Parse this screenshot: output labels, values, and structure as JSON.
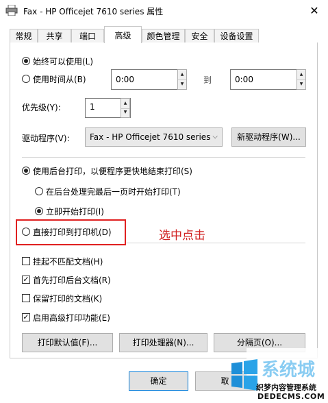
{
  "window": {
    "title": "Fax - HP Officejet 7610 series 属性",
    "close_glyph": "✕"
  },
  "tabs": [
    {
      "label": "常规"
    },
    {
      "label": "共享"
    },
    {
      "label": "端口"
    },
    {
      "label": "高级",
      "active": true
    },
    {
      "label": "颜色管理"
    },
    {
      "label": "安全"
    },
    {
      "label": "设备设置"
    }
  ],
  "availability": {
    "always_label": "始终可以使用(L)",
    "always_selected": true,
    "from_label": "使用时间从(B)",
    "from_time": "0:00",
    "to_label": "到",
    "to_time": "0:00"
  },
  "priority": {
    "label": "优先级(Y):",
    "value": "1"
  },
  "driver": {
    "label": "驱动程序(V):",
    "value": "Fax - HP Officejet 7610 series",
    "new_driver_button": "新驱动程序(W)..."
  },
  "spool": {
    "use_spool_label": "使用后台打印，以便程序更快地结束打印(S)",
    "use_spool_selected": true,
    "after_last_page_label": "在后台处理完最后一页时开始打印(T)",
    "immediately_label": "立即开始打印(I)",
    "immediately_selected": true,
    "direct_label": "直接打印到打印机(D)",
    "direct_selected": false
  },
  "annotation": {
    "text": "选中点击",
    "color": "#d02020"
  },
  "options": [
    {
      "label": "挂起不匹配文档(H)",
      "checked": false
    },
    {
      "label": "首先打印后台文档(R)",
      "checked": true
    },
    {
      "label": "保留打印的文档(K)",
      "checked": false
    },
    {
      "label": "启用高级打印功能(E)",
      "checked": true
    }
  ],
  "bottom_buttons": {
    "defaults": "打印默认值(F)...",
    "processor": "打印处理器(N)...",
    "separator_page": "分隔页(O)..."
  },
  "dialog_buttons": {
    "ok": "确定",
    "cancel": "取"
  },
  "watermark": {
    "line1": "织梦内容管理系统",
    "line2": "DEDECMS.COM",
    "logo_text": "系统城"
  },
  "colors": {
    "accent": "#0078d7",
    "highlight_box": "#e02020"
  }
}
